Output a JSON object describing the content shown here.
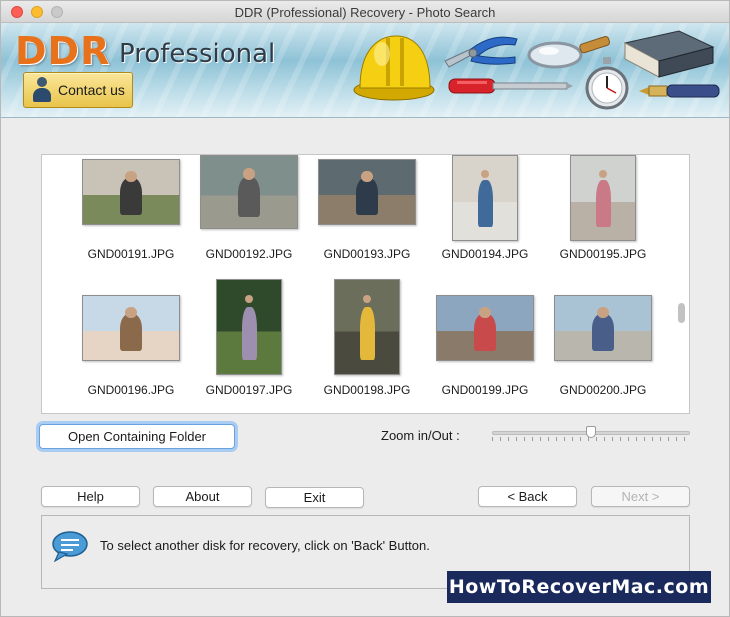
{
  "window": {
    "title": "DDR (Professional) Recovery - Photo Search"
  },
  "banner": {
    "logo_ddr": "DDR",
    "logo_professional": "Professional",
    "contact_label": "Contact us"
  },
  "gallery": {
    "items": [
      {
        "filename": "GND00191.JPG",
        "sky": "#c9c2b6",
        "ground": "#7b8a5a",
        "figure": "#3a3a3a"
      },
      {
        "filename": "GND00192.JPG",
        "sky": "#7f8f8c",
        "ground": "#9a9a8e",
        "figure": "#5a5a5a"
      },
      {
        "filename": "GND00193.JPG",
        "sky": "#5d6a70",
        "ground": "#8b7d6a",
        "figure": "#2e3b4a"
      },
      {
        "filename": "GND00194.JPG",
        "sky": "#d8d4cc",
        "ground": "#e1e0da",
        "figure": "#3f6a9a"
      },
      {
        "filename": "GND00195.JPG",
        "sky": "#cfd2cf",
        "ground": "#b9b0a6",
        "figure": "#c97a86"
      },
      {
        "filename": "GND00196.JPG",
        "sky": "#c7d9e6",
        "ground": "#e6d4c4",
        "figure": "#8a6a4a"
      },
      {
        "filename": "GND00197.JPG",
        "sky": "#2f4a2a",
        "ground": "#5c7a3e",
        "figure": "#9c8fb0"
      },
      {
        "filename": "GND00198.JPG",
        "sky": "#6a6e5a",
        "ground": "#4a4a3e",
        "figure": "#e4b83a"
      },
      {
        "filename": "GND00199.JPG",
        "sky": "#8da6c0",
        "ground": "#8a7a6a",
        "figure": "#c84a4a"
      },
      {
        "filename": "GND00200.JPG",
        "sky": "#a9c2d4",
        "ground": "#b9b7ad",
        "figure": "#4a5e8a"
      }
    ]
  },
  "buttons": {
    "open_folder": "Open Containing Folder",
    "help": "Help",
    "about": "About",
    "exit": "Exit",
    "back": "< Back",
    "next": "Next >"
  },
  "zoom": {
    "label": "Zoom in/Out :",
    "level": 0.5
  },
  "info": {
    "message": "To select another disk for recovery, click on 'Back' Button."
  },
  "watermark": "HowToRecoverMac.com"
}
